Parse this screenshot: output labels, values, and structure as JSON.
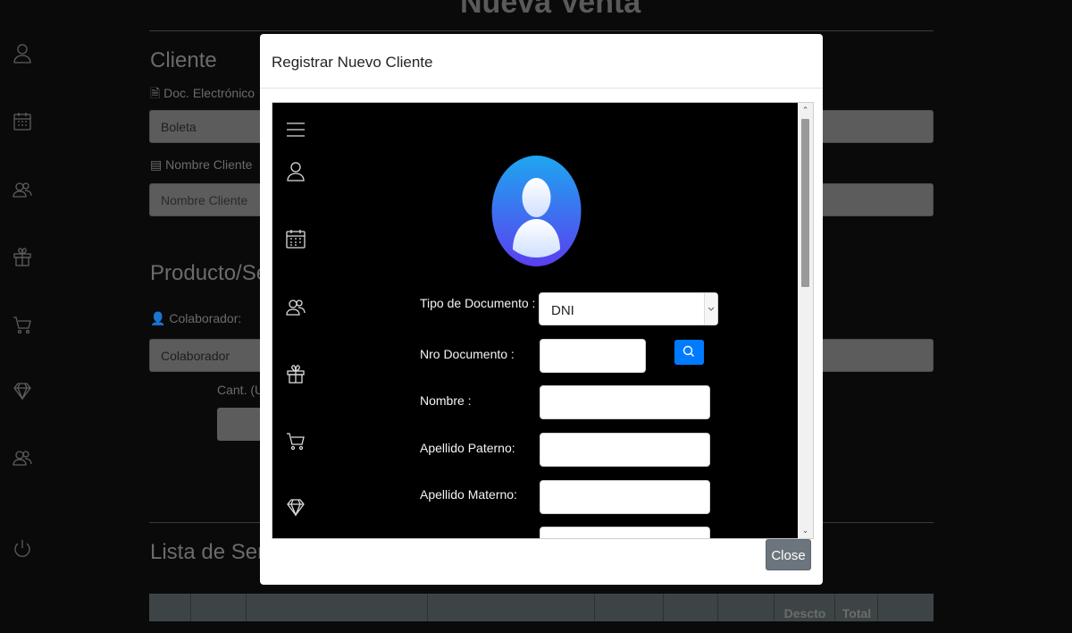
{
  "page": {
    "title": "Nueva Venta",
    "cliente_heading": "Cliente",
    "doc_label": "Doc. Electrónico",
    "doc_value": "Boleta",
    "nombre_label": "Nombre Cliente",
    "nombre_placeholder": "Nombre Cliente",
    "producto_heading": "Producto/Se",
    "colaborador_label": "Colaborador:",
    "colaborador_value": "Colaborador",
    "cant_label": "Cant. (U",
    "lista_heading": "Lista de Serv",
    "table_headers": [
      "Descto",
      "Total"
    ]
  },
  "sidebar": {
    "icons": [
      "user-icon",
      "calendar-icon",
      "users-icon",
      "gift-icon",
      "cart-icon",
      "diamond-icon",
      "users-icon",
      "power-icon"
    ]
  },
  "modal": {
    "title": "Registrar Nuevo Cliente",
    "close_label": "Close",
    "form": {
      "tipo_documento_label": "Tipo de Documento :",
      "tipo_documento_value": "DNI",
      "nro_documento_label": "Nro Documento :",
      "nombre_label": "Nombre :",
      "apellido_paterno_label": "Apellido Paterno:",
      "apellido_materno_label": "Apellido Materno:"
    }
  },
  "colors": {
    "modal_bg": "#ffffff",
    "search_button": "#007bff",
    "close_button": "#6c757d",
    "avatar_gradient_top": "#1ea6f0",
    "avatar_gradient_bottom": "#5a3ff0"
  }
}
